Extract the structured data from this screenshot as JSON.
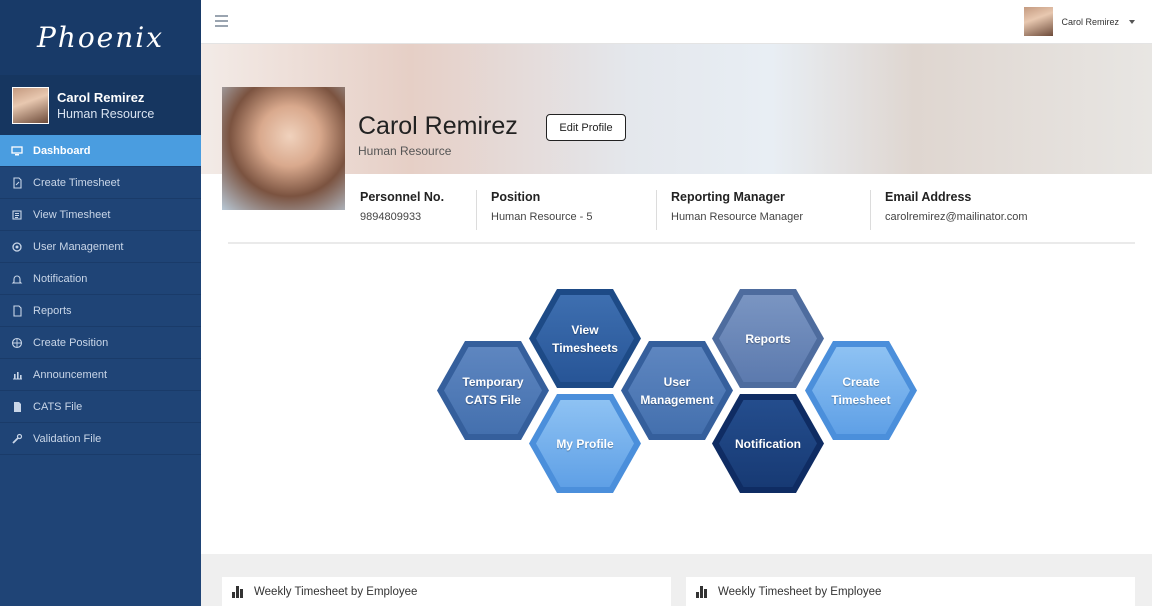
{
  "app": {
    "logo": "Phoenix"
  },
  "sidebar": {
    "user": {
      "name": "Carol Remirez",
      "role": "Human Resource"
    },
    "items": [
      {
        "label": "Dashboard",
        "icon": "monitor-icon"
      },
      {
        "label": "Create Timesheet",
        "icon": "document-edit-icon"
      },
      {
        "label": "View Timesheet",
        "icon": "list-icon"
      },
      {
        "label": "User Management",
        "icon": "gear-icon"
      },
      {
        "label": "Notification",
        "icon": "bell-icon"
      },
      {
        "label": "Reports",
        "icon": "document-icon"
      },
      {
        "label": "Create Position",
        "icon": "globe-icon"
      },
      {
        "label": "Announcement",
        "icon": "bar-chart-icon"
      },
      {
        "label": "CATS File",
        "icon": "file-icon"
      },
      {
        "label": "Validation File",
        "icon": "wrench-icon"
      }
    ]
  },
  "topbar": {
    "user_name": "Carol Remirez"
  },
  "profile": {
    "name": "Carol Remirez",
    "role": "Human Resource",
    "edit_label": "Edit Profile",
    "details": [
      {
        "heading": "Personnel No.",
        "value": "9894809933"
      },
      {
        "heading": "Position",
        "value": "Human Resource - 5"
      },
      {
        "heading": "Reporting Manager",
        "value": "Human Resource Manager"
      },
      {
        "heading": "Email Address",
        "value": "carolremirez@mailinator.com"
      }
    ]
  },
  "tiles": {
    "temporary_cats_file": "Temporary CATS File",
    "view_timesheets": "View Timesheets",
    "my_profile": "My Profile",
    "user_management": "User Management",
    "reports": "Reports",
    "notification": "Notification",
    "create_timesheet": "Create Timesheet"
  },
  "panels": [
    {
      "title": "Weekly Timesheet by Employee"
    },
    {
      "title": "Weekly Timesheet by Employee"
    }
  ],
  "colors": {
    "sidebar": "#1f4476",
    "active_item": "#4a9de0"
  }
}
